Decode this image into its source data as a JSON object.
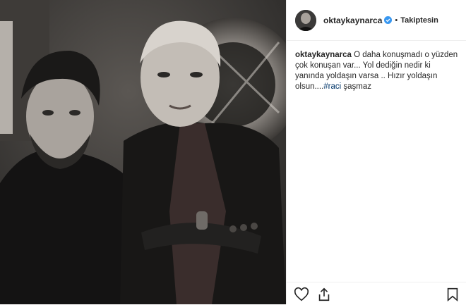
{
  "post": {
    "account": {
      "username": "oktaykaynarca",
      "verified": true,
      "separator": "•",
      "follow_status": "Takiptesin"
    },
    "caption": {
      "username": "oktaykaynarca",
      "text": " O daha konuşmadı o yüzden çok konuşan var... Yol dediğin nedir ki yanında yoldaşın varsa .. Hızır yoldaşın olsun....",
      "hashtag": "#raci",
      "tail": " şaşmaz"
    },
    "actions": [
      {
        "icon": "heart-icon",
        "label": "like"
      },
      {
        "icon": "share-icon",
        "label": "share"
      },
      {
        "icon": "bookmark-icon",
        "label": "save"
      }
    ],
    "colors": {
      "verified_badge": "#3897f0",
      "hashtag": "#003569",
      "text": "#262626",
      "divider": "#efefef"
    }
  }
}
